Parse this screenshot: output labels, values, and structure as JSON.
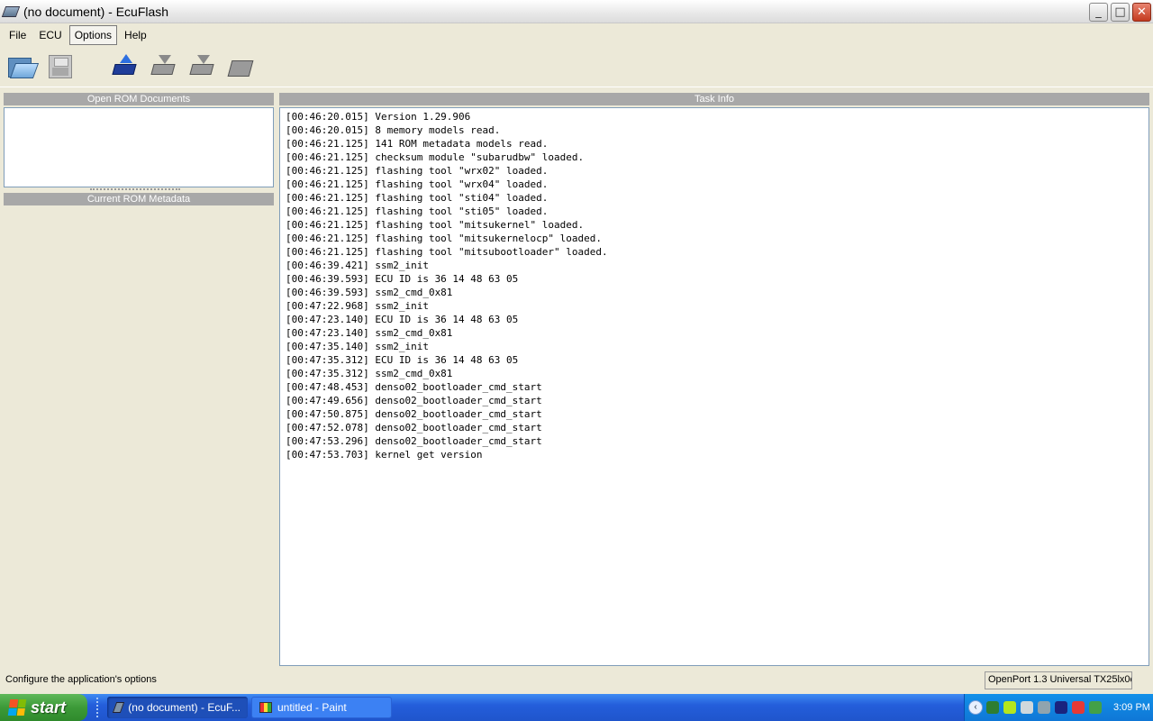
{
  "window": {
    "title": "(no document) - EcuFlash",
    "buttons": {
      "minimize": "_",
      "maximize": "□",
      "close": "✕"
    }
  },
  "menu": [
    "File",
    "ECU",
    "Options",
    "Help"
  ],
  "toolbar": {
    "icons": [
      "open-folder-icon",
      "save-disk-icon",
      "read-rom-icon",
      "write-rom-icon",
      "test-write-icon",
      "chip-icon"
    ]
  },
  "left_panel": {
    "open_rom_header": "Open ROM Documents",
    "metadata_header": "Current ROM Metadata"
  },
  "task_info": {
    "header": "Task Info",
    "log": [
      "[00:46:20.015] Version 1.29.906",
      "[00:46:20.015] 8 memory models read.",
      "[00:46:21.125] 141 ROM metadata models read.",
      "[00:46:21.125] checksum module \"subarudbw\" loaded.",
      "[00:46:21.125] flashing tool \"wrx02\" loaded.",
      "[00:46:21.125] flashing tool \"wrx04\" loaded.",
      "[00:46:21.125] flashing tool \"sti04\" loaded.",
      "[00:46:21.125] flashing tool \"sti05\" loaded.",
      "[00:46:21.125] flashing tool \"mitsukernel\" loaded.",
      "[00:46:21.125] flashing tool \"mitsukernelocp\" loaded.",
      "[00:46:21.125] flashing tool \"mitsubootloader\" loaded.",
      "[00:46:39.421] ssm2_init",
      "[00:46:39.593] ECU ID is 36 14 48 63 05",
      "[00:46:39.593] ssm2_cmd_0x81",
      "[00:47:22.968] ssm2_init",
      "[00:47:23.140] ECU ID is 36 14 48 63 05",
      "[00:47:23.140] ssm2_cmd_0x81",
      "[00:47:35.140] ssm2_init",
      "[00:47:35.312] ECU ID is 36 14 48 63 05",
      "[00:47:35.312] ssm2_cmd_0x81",
      "[00:47:48.453] denso02_bootloader_cmd_start",
      "[00:47:49.656] denso02_bootloader_cmd_start",
      "[00:47:50.875] denso02_bootloader_cmd_start",
      "[00:47:52.078] denso02_bootloader_cmd_start",
      "[00:47:53.296] denso02_bootloader_cmd_start",
      "[00:47:53.703] kernel get version"
    ]
  },
  "status_bar": {
    "message": "Configure the application's options",
    "device": "OpenPort 1.3 Universal TX25lx0c"
  },
  "taskbar": {
    "start_label": "start",
    "tasks": [
      "(no document) - EcuF...",
      "untitled - Paint"
    ],
    "tray_collapse": "‹",
    "clock": "3:09 PM"
  }
}
